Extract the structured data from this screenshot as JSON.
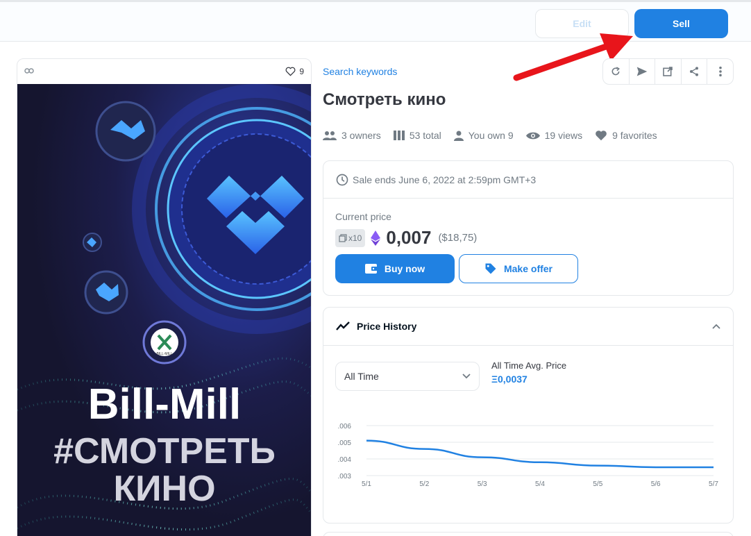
{
  "toolbar": {
    "edit_label": "Edit",
    "sell_label": "Sell"
  },
  "item": {
    "favorites_count": "9",
    "image_title": "Bill-Mill",
    "image_subtitle_line1": "#СМОТРЕТЬ",
    "image_subtitle_line2": "КИНО",
    "badge_text": "BILL-MILL"
  },
  "header": {
    "keywords_link": "Search keywords",
    "title": "Смотреть кино",
    "stats": {
      "owners": "3 owners",
      "total": "53 total",
      "you_own": "You own 9",
      "views": "19 views",
      "favorites": "9 favorites"
    }
  },
  "sale": {
    "ends_text": "Sale ends June 6, 2022 at 2:59pm GMT+3",
    "current_price_label": "Current price",
    "quantity": "x10",
    "price": "0,007",
    "fiat": "($18,75)",
    "buy_label": "Buy now",
    "offer_label": "Make offer"
  },
  "price_history": {
    "title": "Price History",
    "range_selected": "All Time",
    "avg_label": "All Time Avg. Price",
    "avg_value": "Ξ0,0037"
  },
  "colors": {
    "accent": "#2081e2",
    "border": "#e5e8eb",
    "arrow": "#e8151b"
  },
  "chart_data": {
    "type": "line",
    "x": [
      "5/1",
      "5/2",
      "5/3",
      "5/4",
      "5/5",
      "5/6",
      "5/7"
    ],
    "y_ticks": [
      ".006",
      ".005",
      ".004",
      ".003"
    ],
    "ylim": [
      0.003,
      0.006
    ],
    "series": [
      {
        "values": [
          0.0051,
          0.0046,
          0.0041,
          0.0038,
          0.0036,
          0.0035,
          0.0035
        ]
      }
    ],
    "grid": true
  }
}
